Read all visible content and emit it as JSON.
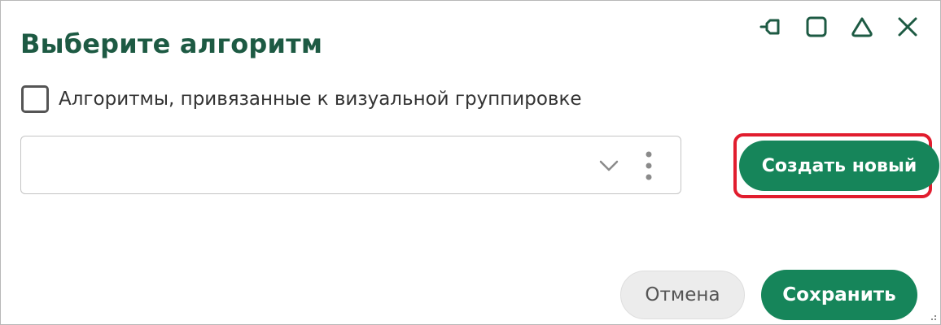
{
  "dialog": {
    "title": "Выберите алгоритм",
    "checkbox": {
      "label": "Алгоритмы, привязанные к визуальной группировке",
      "checked": false
    },
    "select": {
      "value": ""
    },
    "buttons": {
      "create_label": "Создать новый",
      "cancel_label": "Отмена",
      "save_label": "Сохранить"
    }
  },
  "window_controls": {
    "icons": [
      "dock-icon",
      "maximize-icon",
      "collapse-icon",
      "close-icon"
    ]
  },
  "colors": {
    "title": "#1d5a43",
    "primary": "#16855a",
    "highlight": "#e11d2e",
    "icon": "#1d5a43"
  }
}
